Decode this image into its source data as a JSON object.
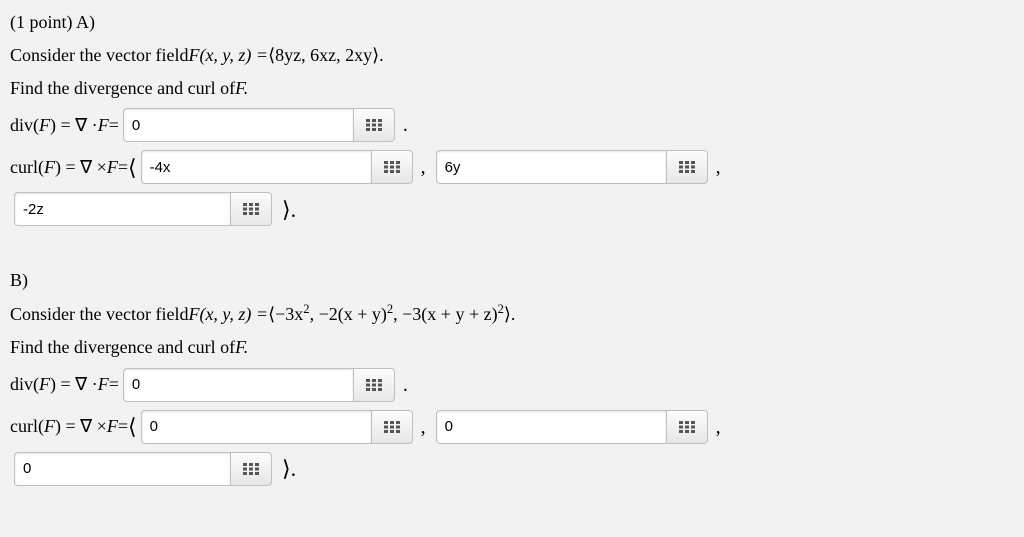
{
  "partA": {
    "header": "(1 point) A)",
    "consider_prefix": "Consider the vector field ",
    "F_expr_prefix": "F(x, y, z) = ",
    "F_expr_tuple": "⟨8yz, 6xz, 2xy⟩.",
    "find_line": "Find the divergence and curl of ",
    "F_period": "F.",
    "div_label_prefix": "div(",
    "div_mid": ") = ∇ · ",
    "div_after": " = ",
    "div_value": "0",
    "curl_label_prefix": "curl(",
    "curl_mid": ") = ∇ × ",
    "curl_after": " = ",
    "curl_open": "⟨",
    "curl_close": "⟩.",
    "curl_i": "-4x",
    "curl_j": "6y",
    "curl_k": "-2z",
    "comma": ",",
    "period": "."
  },
  "partB": {
    "header": "B)",
    "consider_prefix": "Consider the vector field ",
    "F_expr_prefix": "F(x, y, z) = ",
    "F_expr_tuple_a": "⟨−3x",
    "F_expr_tuple_b": ", −2(x + y)",
    "F_expr_tuple_c": ", −3(x + y + z)",
    "F_expr_tuple_end": "⟩.",
    "sq": "2",
    "find_line": "Find the divergence and curl of ",
    "F_period": "F.",
    "div_value": "0",
    "curl_i": "0",
    "curl_j": "0",
    "curl_k": "0"
  }
}
